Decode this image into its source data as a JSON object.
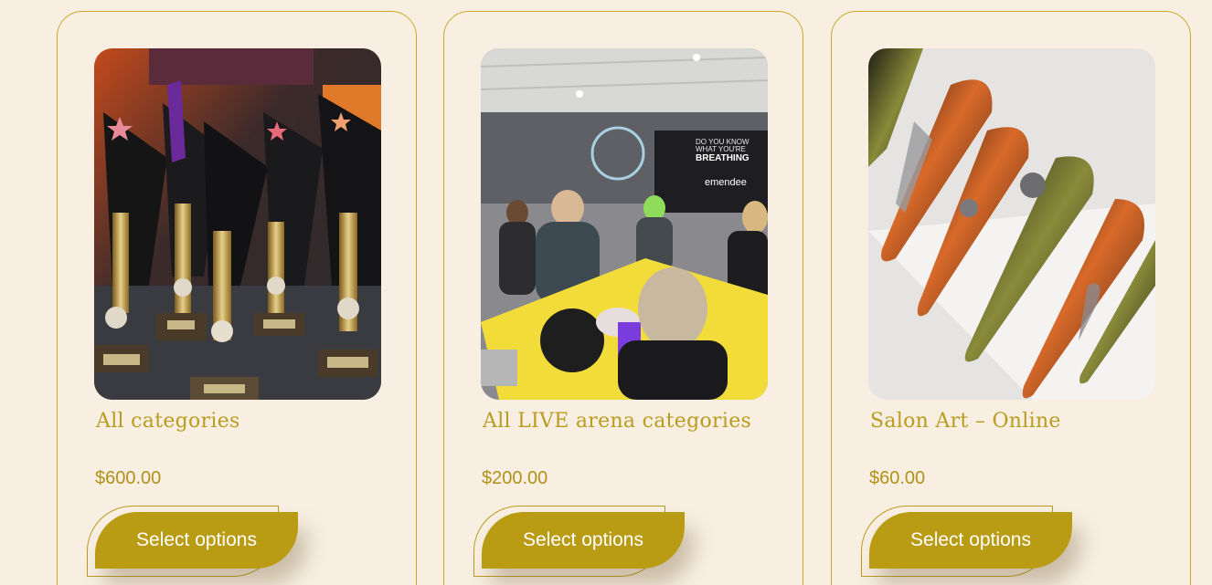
{
  "products": [
    {
      "title": "All categories",
      "price": "$600.00",
      "button_label": "Select options",
      "image": "trophies-photo"
    },
    {
      "title": "All LIVE arena categories",
      "price": "$200.00",
      "button_label": "Select options",
      "image": "nail-competition-arena-photo",
      "image_text": {
        "banner_line1": "DO YOU KNOW",
        "banner_line2": "WHAT YOU'RE",
        "banner_line3": "BREATHING",
        "brand": "emendee"
      }
    },
    {
      "title": "Salon Art – Online",
      "price": "$60.00",
      "button_label": "Select options",
      "image": "decorated-stiletto-nails-photo"
    }
  ],
  "colors": {
    "background": "#f8efe2",
    "accent": "#b99b14",
    "title": "#b99c1e",
    "border": "#c9a92a"
  }
}
